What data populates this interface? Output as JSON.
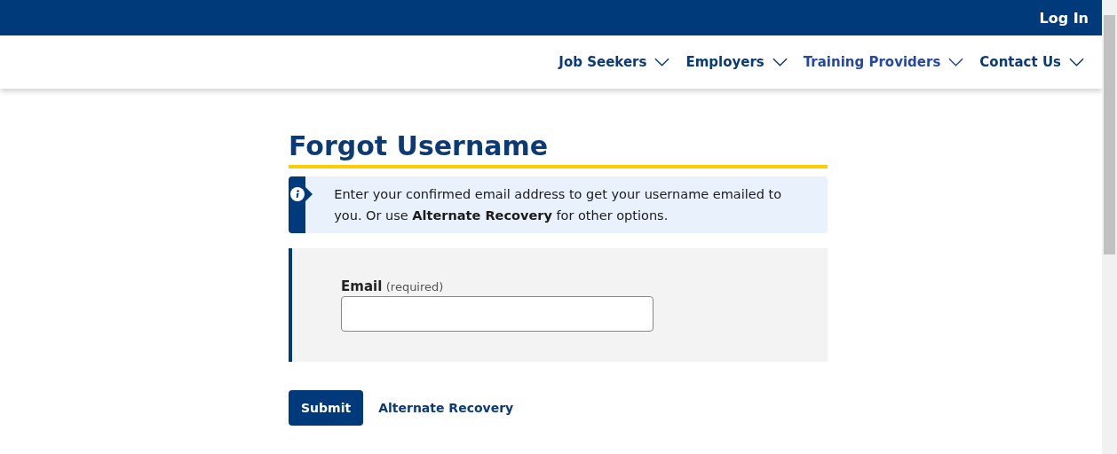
{
  "top_bar": {
    "login": "Log In"
  },
  "nav": [
    {
      "label": "Job Seekers",
      "hovered": false
    },
    {
      "label": "Employers",
      "hovered": false
    },
    {
      "label": "Training Providers",
      "hovered": true
    },
    {
      "label": "Contact Us",
      "hovered": false
    }
  ],
  "page": {
    "title": "Forgot Username",
    "notice": "Enter your confirmed email address to get your username emailed to you. Or use **Alternate Recovery** for other options.",
    "email": {
      "label": "Email",
      "hint": "(required)"
    },
    "submit": "Submit",
    "alternate_link": "Alternate Recovery"
  }
}
